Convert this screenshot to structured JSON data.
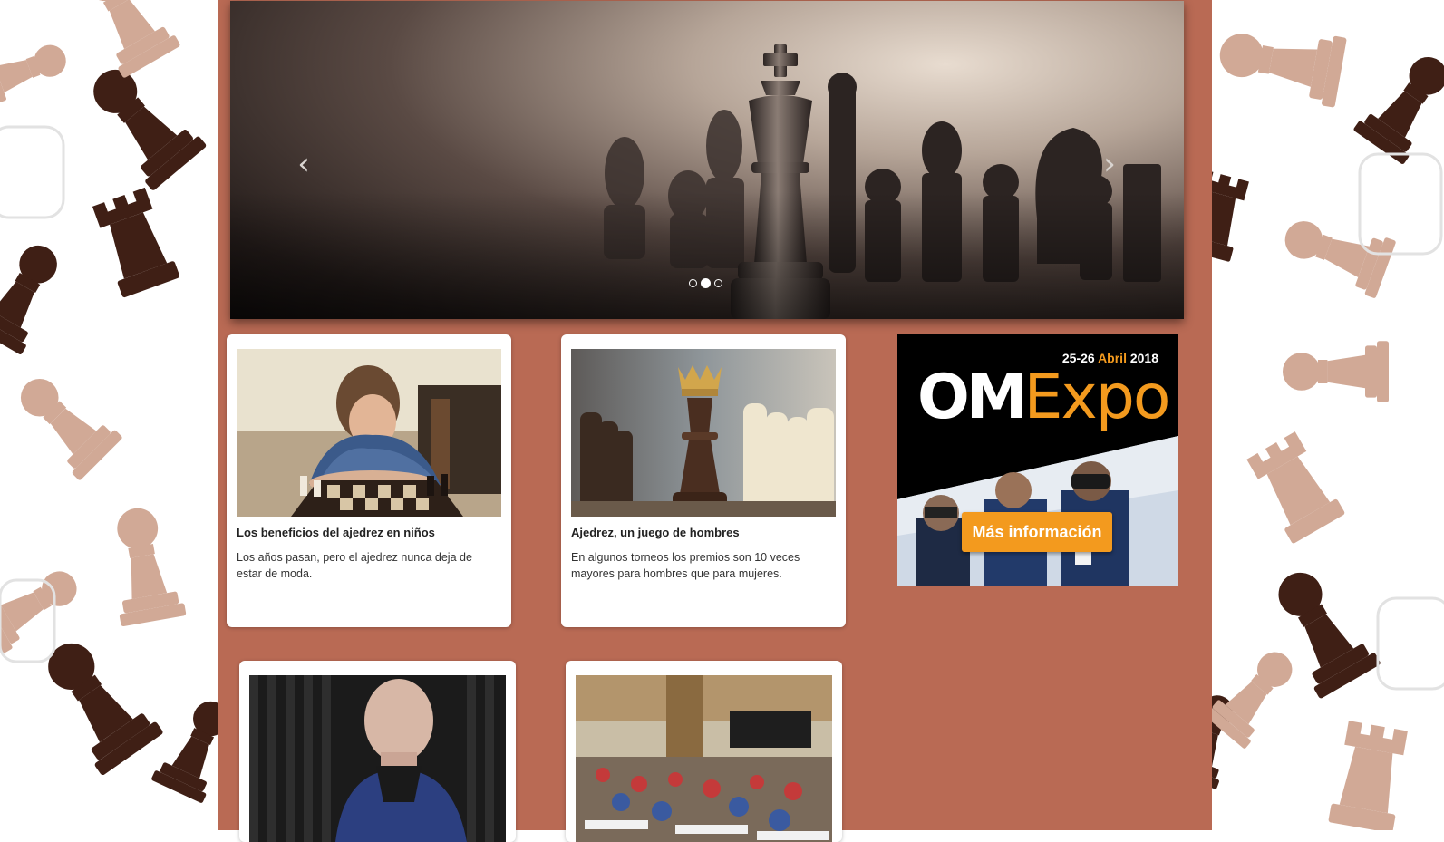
{
  "colors": {
    "content_bg": "#b96a54",
    "pattern_dark": "#3f1f15",
    "pattern_light": "#d1a996",
    "ad_accent": "#f39a1e"
  },
  "carousel": {
    "prev_icon": "chevron-left-icon",
    "next_icon": "chevron-right-icon",
    "prev_label": "‹",
    "next_label": "›",
    "slide_count": 3,
    "active_slide": 2
  },
  "articles": [
    {
      "title": "Los beneficios del ajedrez en niños",
      "excerpt": "Los años pasan, pero el ajedrez nunca deja de estar de moda.",
      "image": "boy-playing-chess-photo"
    },
    {
      "title": "Ajedrez, un juego de hombres",
      "excerpt": "En algunos torneos los premios son 10 veces mayores para hombres que para mujeres.",
      "image": "crowned-chess-king-photo"
    },
    {
      "title": "",
      "excerpt": "",
      "image": "bald-man-portrait-photo"
    },
    {
      "title": "",
      "excerpt": "",
      "image": "kids-chess-tournament-photo"
    }
  ],
  "ad": {
    "dates_prefix": "25-26",
    "dates_month": "Abril",
    "dates_year": "2018",
    "logo_om": "OM",
    "logo_expo": "Expo",
    "cta_label": "Más información"
  }
}
